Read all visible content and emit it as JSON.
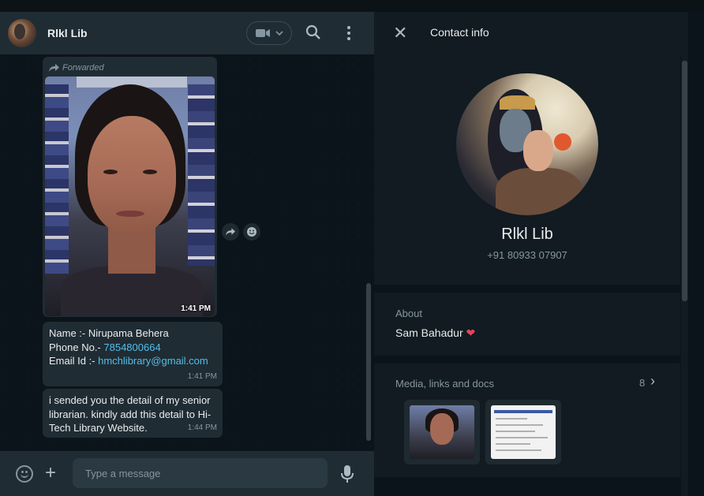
{
  "chat": {
    "contact_name": "Rlkl Lib",
    "forwarded_label": "Forwarded",
    "messages": [
      {
        "type": "image",
        "time": "1:41 PM"
      },
      {
        "type": "text",
        "line1": "Name :- Nirupama Behera",
        "phone_prefix": "Phone No.- ",
        "phone": "7854800664",
        "email_prefix": "Email Id :- ",
        "email": "hmchlibrary@gmail.com",
        "time": "1:41 PM"
      },
      {
        "type": "text",
        "text": "i sended you the detail of my senior librarian. kindly add this detail to Hi-Tech Library Website.",
        "time": "1:44 PM"
      }
    ],
    "composer": {
      "placeholder": "Type a message"
    }
  },
  "contact_info": {
    "title": "Contact info",
    "name": "Rlkl Lib",
    "phone": "+91 80933 07907",
    "about_label": "About",
    "about_text": "Sam Bahadur",
    "about_emoji": "❤",
    "media_label": "Media, links and docs",
    "media_count": "8"
  },
  "icons": [
    "video-call-icon",
    "search-icon",
    "menu-icon",
    "forward-icon",
    "emoji-icon",
    "plus-icon",
    "mic-icon",
    "close-icon",
    "chevron-right-icon"
  ],
  "colors": {
    "panel": "#111b21",
    "bubble": "#202c33",
    "link": "#53bdeb",
    "text": "#e9edef",
    "muted": "#8696a0"
  }
}
